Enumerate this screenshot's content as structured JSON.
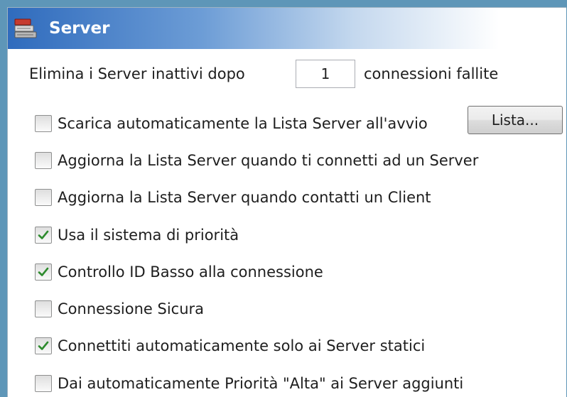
{
  "header": {
    "title": "Server",
    "icon": "server-icon"
  },
  "inactive": {
    "prefix": "Elimina i Server inattivi dopo",
    "value": "1",
    "suffix": "connessioni fallite"
  },
  "list_button": "Lista...",
  "options": [
    {
      "label": "Scarica automaticamente la Lista Server all'avvio",
      "checked": false
    },
    {
      "label": "Aggiorna la Lista Server quando ti connetti ad un Server",
      "checked": false
    },
    {
      "label": "Aggiorna la Lista Server quando contatti un Client",
      "checked": false
    },
    {
      "label": "Usa il sistema di priorità",
      "checked": true
    },
    {
      "label": "Controllo ID Basso alla connessione",
      "checked": true
    },
    {
      "label": "Connessione Sicura",
      "checked": false
    },
    {
      "label": "Connettiti automaticamente solo ai Server statici",
      "checked": true
    },
    {
      "label": "Dai automaticamente Priorità \"Alta\" ai Server aggiunti",
      "checked": false
    }
  ],
  "colors": {
    "accent": "#2f6bbd",
    "check": "#2e8b2e"
  }
}
